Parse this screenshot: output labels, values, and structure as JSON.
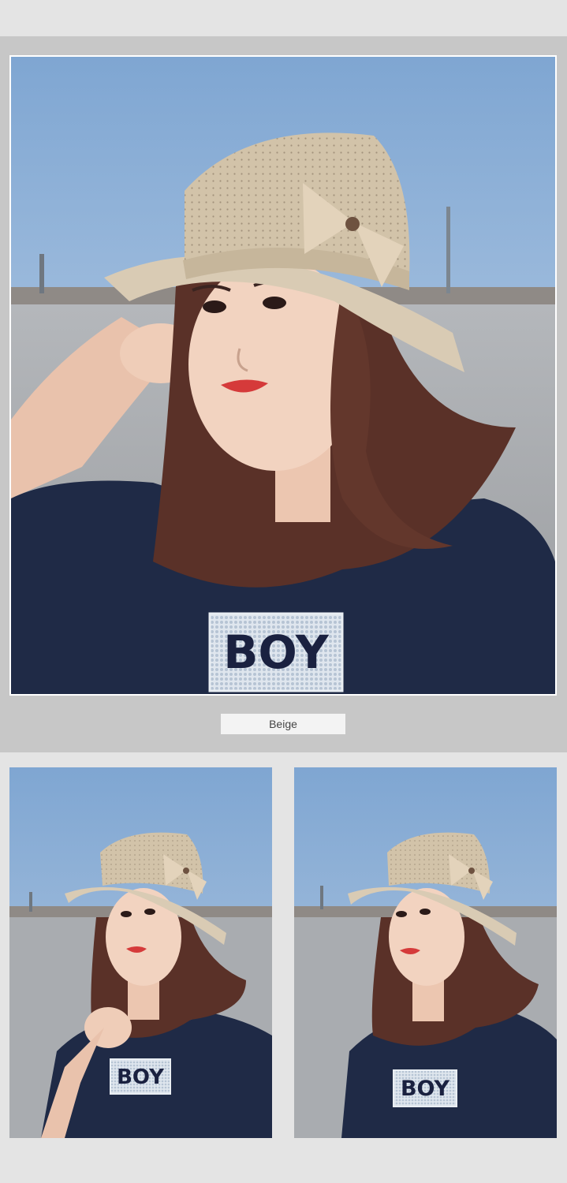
{
  "color_label": "Beige",
  "shirt_text": "BOY",
  "colors": {
    "page_bg": "#e4e4e4",
    "panel_bg": "#c7c7c7",
    "sky": "#8fb2d8",
    "hat": "#d9cbb4",
    "shirt": "#1f2a46",
    "hair": "#5a3128"
  }
}
